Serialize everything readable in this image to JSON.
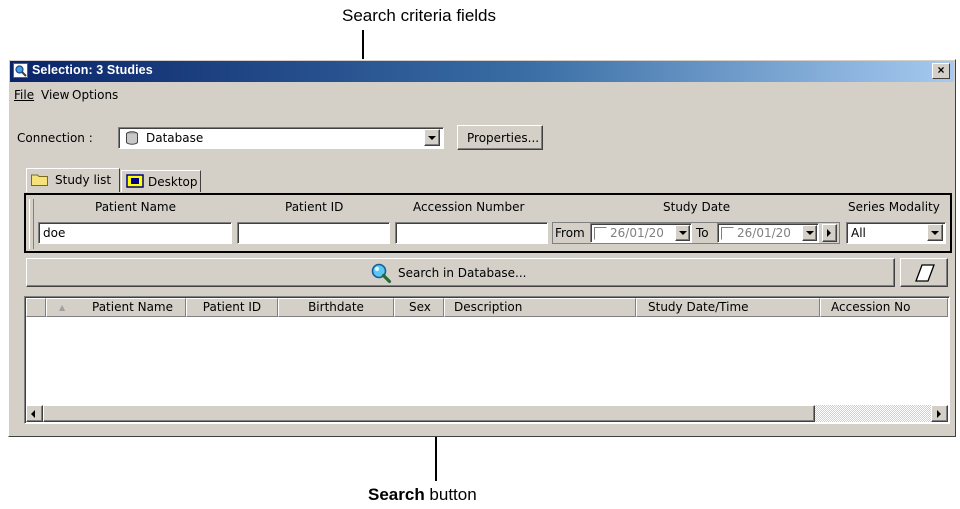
{
  "callouts": {
    "top": "Search criteria fields",
    "bottom_bold": "Search",
    "bottom_rest": " button"
  },
  "window": {
    "title": "Selection: 3 Studies",
    "close_label": "×"
  },
  "menu": [
    "File",
    "View",
    "Options"
  ],
  "connection": {
    "label": "Connection :",
    "value": "Database",
    "properties_label": "Properties..."
  },
  "tabs": [
    {
      "label": "Study list",
      "active": true
    },
    {
      "label": "Desktop",
      "active": false
    }
  ],
  "criteria": {
    "patient_name_label": "Patient Name",
    "patient_name_value": "doe",
    "patient_id_label": "Patient ID",
    "patient_id_value": "",
    "accession_label": "Accession Number",
    "accession_value": "",
    "study_date_label": "Study Date",
    "from_label": "From",
    "from_value": "26/01/20",
    "to_label": "To",
    "to_value": "26/01/20",
    "series_modality_label": "Series Modality",
    "series_modality_value": "All"
  },
  "search_button_label": "Search in Database...",
  "table": {
    "sort_indicator": "▲",
    "columns": [
      "Patient Name",
      "Patient ID",
      "Birthdate",
      "Sex",
      "Description",
      "Study Date/Time",
      "Accession No"
    ],
    "rows": []
  },
  "colors": {
    "title_gradient_start": "#0a246a",
    "title_gradient_end": "#a6caf0",
    "window_face": "#d4d0c8"
  },
  "icons": [
    "search-window-icon",
    "database-icon",
    "folder-icon",
    "desktop-icon",
    "magnifier-icon",
    "eraser-icon"
  ]
}
